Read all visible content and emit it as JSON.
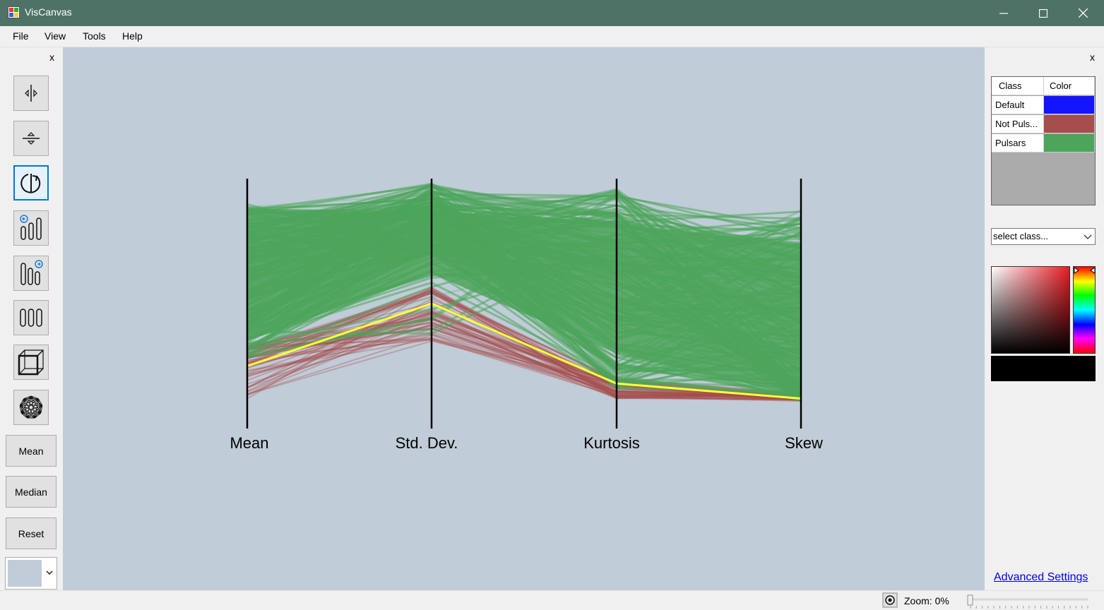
{
  "window": {
    "title": "VisCanvas",
    "controls": [
      "minimize-icon",
      "maximize-icon",
      "close-icon"
    ]
  },
  "menu": {
    "items": [
      "File",
      "View",
      "Tools",
      "Help"
    ]
  },
  "left_toolbar": {
    "close_label": "x",
    "tools": [
      {
        "name": "swap-axes-horizontal",
        "icon": "horizontal-split-arrows-icon"
      },
      {
        "name": "swap-axes-vertical",
        "icon": "vertical-split-arrows-icon"
      },
      {
        "name": "rotate",
        "icon": "rotate-icon",
        "active": true
      },
      {
        "name": "add-axis-left",
        "icon": "add-axis-left-icon"
      },
      {
        "name": "add-axis-right",
        "icon": "add-axis-right-icon"
      },
      {
        "name": "axes",
        "icon": "three-axes-icon"
      },
      {
        "name": "cube-view",
        "icon": "cube-icon"
      },
      {
        "name": "radial-view",
        "icon": "star-polygon-icon"
      }
    ],
    "buttons": [
      "Mean",
      "Median",
      "Reset"
    ],
    "background_color": "#c0ccd8"
  },
  "chart_data": {
    "type": "parallel-coordinates",
    "axes": [
      "Mean",
      "Std. Dev.",
      "Kurtosis",
      "Skew"
    ],
    "classes": [
      {
        "name": "Not Puls...",
        "color": "#a64d4d"
      },
      {
        "name": "Pulsars",
        "color": "#4ca55b"
      }
    ],
    "highlight": {
      "name": "",
      "color": "#ffff33",
      "values": [
        0.25,
        0.5,
        0.18,
        0.12
      ]
    }
  },
  "right_panel": {
    "close_label": "x",
    "class_table": {
      "headers": [
        "Class",
        "Color"
      ],
      "rows": [
        {
          "name": "Default",
          "color": "#1414ff"
        },
        {
          "name": "Not Puls...",
          "color": "#a64d4d"
        },
        {
          "name": "Pulsars",
          "color": "#4ca55b"
        }
      ]
    },
    "class_select_placeholder": "select class...",
    "preview_color": "#000000",
    "advanced_settings": "Advanced Settings"
  },
  "status": {
    "zoom_text": "Zoom: 0%",
    "zoom_value": 0
  }
}
